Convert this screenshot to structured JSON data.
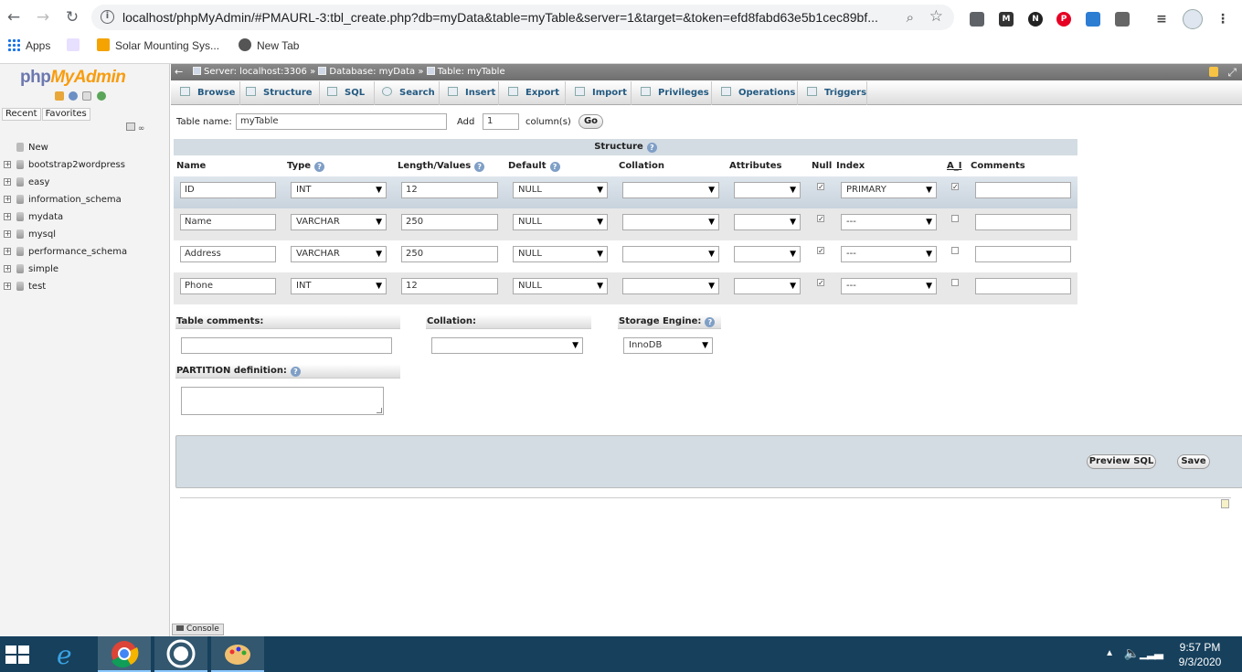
{
  "browser": {
    "url": "localhost/phpMyAdmin/#PMAURL-3:tbl_create.php?db=myData&table=myTable&server=1&target=&token=efd8fabd63e5b1cec89bf...",
    "bookmarks": [
      {
        "label": "Apps"
      },
      {
        "label": ""
      },
      {
        "label": "Solar Mounting Sys..."
      },
      {
        "label": "New Tab"
      }
    ]
  },
  "nav": {
    "logo_php": "php",
    "logo_myadmin": "MyAdmin",
    "tabs": [
      "Recent",
      "Favorites"
    ],
    "tree": [
      {
        "label": "New"
      },
      {
        "label": "bootstrap2wordpress"
      },
      {
        "label": "easy"
      },
      {
        "label": "information_schema"
      },
      {
        "label": "mydata"
      },
      {
        "label": "mysql"
      },
      {
        "label": "performance_schema"
      },
      {
        "label": "simple"
      },
      {
        "label": "test"
      }
    ]
  },
  "breadcrumb": {
    "server": "Server: localhost:3306",
    "database": "Database: myData",
    "table": "Table: myTable",
    "sep": "»"
  },
  "menu": [
    "Browse",
    "Structure",
    "SQL",
    "Search",
    "Insert",
    "Export",
    "Import",
    "Privileges",
    "Operations",
    "Triggers"
  ],
  "form": {
    "table_name_label": "Table name:",
    "table_name": "myTable",
    "add_label": "Add",
    "add_count": "1",
    "columns_label": "column(s)",
    "go_label": "Go",
    "structure_title": "Structure",
    "headers": {
      "name": "Name",
      "type": "Type",
      "length": "Length/Values",
      "default": "Default",
      "collation": "Collation",
      "attributes": "Attributes",
      "null": "Null",
      "index": "Index",
      "ai": "A_I",
      "comments": "Comments"
    },
    "rows": [
      {
        "name": "ID",
        "type": "INT",
        "length": "12",
        "default": "NULL",
        "null": true,
        "index": "PRIMARY",
        "ai": true
      },
      {
        "name": "Name",
        "type": "VARCHAR",
        "length": "250",
        "default": "NULL",
        "null": true,
        "index": "---",
        "ai": false
      },
      {
        "name": "Address",
        "type": "VARCHAR",
        "length": "250",
        "default": "NULL",
        "null": true,
        "index": "---",
        "ai": false
      },
      {
        "name": "Phone",
        "type": "INT",
        "length": "12",
        "default": "NULL",
        "null": true,
        "index": "---",
        "ai": false
      }
    ],
    "table_comments_label": "Table comments:",
    "collation_label": "Collation:",
    "storage_engine_label": "Storage Engine:",
    "storage_engine": "InnoDB",
    "partition_label": "PARTITION definition:",
    "preview_sql_label": "Preview SQL",
    "save_label": "Save",
    "console_label": "Console"
  },
  "taskbar": {
    "time": "9:57 PM",
    "date": "9/3/2020"
  }
}
